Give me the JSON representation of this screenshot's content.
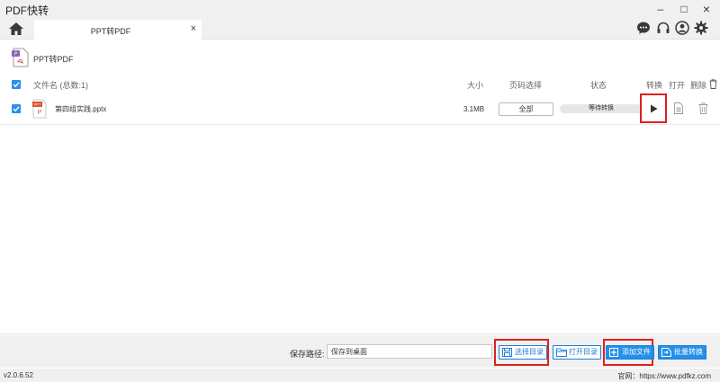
{
  "window": {
    "title": "PDF快转",
    "minimize": "–",
    "maximize": "□",
    "close": "×"
  },
  "tabs": [
    {
      "label": "PPT转PDF",
      "close": "×",
      "active": true
    }
  ],
  "toolbar_icons": [
    "chat-icon",
    "headset-icon",
    "user-icon",
    "gear-icon"
  ],
  "page": {
    "heading": "PPT转PDF"
  },
  "table": {
    "columns": {
      "filename": "文件名 (总数:1)",
      "size": "大小",
      "page_range": "页码选择",
      "status": "状态",
      "convert": "转换",
      "open": "打开",
      "delete": "删除"
    },
    "rows": [
      {
        "checked": true,
        "name": "第四组实践.pptx",
        "size": "3.1MB",
        "page_range": "全部",
        "status": "等待转换"
      }
    ]
  },
  "bottom": {
    "save_path_label": "保存路径:",
    "save_path_value": "保存到桌面",
    "choose_dir": "选择目录",
    "open_dir": "打开目录",
    "add_file": "添加文件",
    "batch_convert": "批量转换"
  },
  "statusbar": {
    "version": "v2.0.6.52",
    "website": "官网：https://www.pdfkz.com"
  },
  "colors": {
    "accent": "#2590e8",
    "highlight": "#e01e1e",
    "chrome": "#f0f0f0"
  }
}
